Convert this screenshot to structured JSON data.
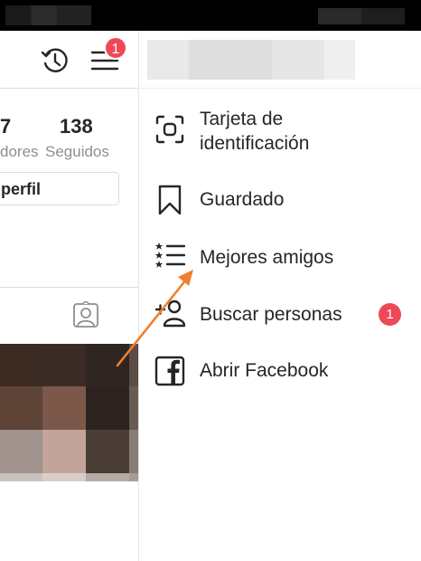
{
  "profile": {
    "following_count": "138",
    "following_label": "Seguidos",
    "followers_count_partial": "7",
    "followers_label_partial": "dores",
    "edit_button_partial": "perfil",
    "menu_badge": "1"
  },
  "drawer": {
    "items": [
      {
        "label": "Tarjeta de\nidentificación",
        "icon": "nametag-icon"
      },
      {
        "label": "Guardado",
        "icon": "bookmark-icon"
      },
      {
        "label": "Mejores amigos",
        "icon": "close-friends-list-icon"
      },
      {
        "label": "Buscar personas",
        "icon": "add-person-icon",
        "badge": "1"
      },
      {
        "label": "Abrir Facebook",
        "icon": "facebook-icon"
      }
    ]
  },
  "colors": {
    "badge": "#ed4956",
    "arrow": "#f07f2c",
    "text": "#262626",
    "muted": "#8e8e8e"
  }
}
